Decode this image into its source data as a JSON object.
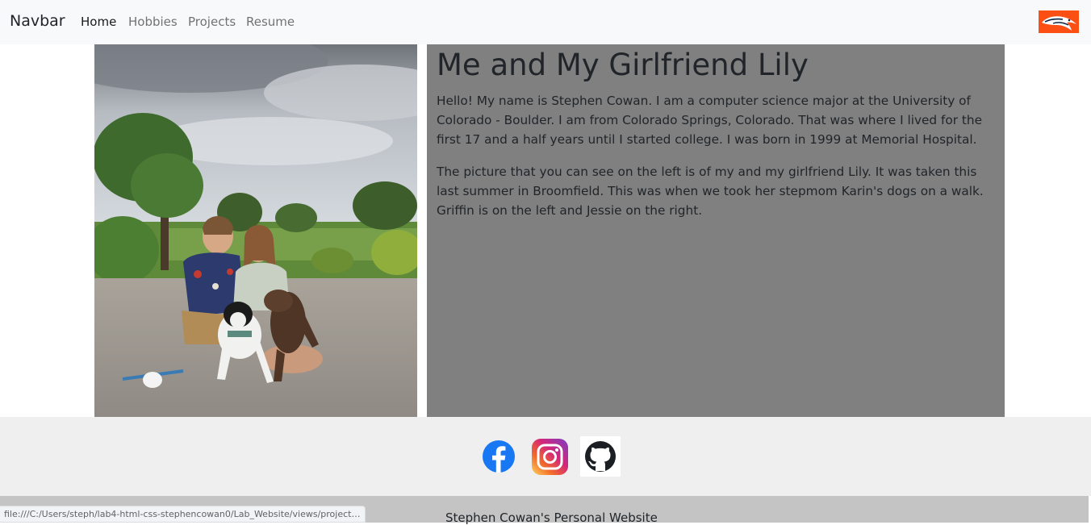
{
  "navbar": {
    "brand": "Navbar",
    "links": [
      {
        "label": "Home"
      },
      {
        "label": "Hobbies"
      },
      {
        "label": "Projects"
      },
      {
        "label": "Resume"
      }
    ],
    "logo_icon": "broncos-logo-icon"
  },
  "main": {
    "photo_icon": "couple-with-dogs-photo",
    "heading": "Me and My Girlfriend Lily",
    "paragraphs": [
      "Hello! My name is Stephen Cowan. I am a computer science major at the University of Colorado - Boulder. I am from Colorado Springs, Colorado. That was where I lived for the first 17 and a half years until I started college. I was born in 1999 at Memorial Hospital.",
      "The picture that you can see on the left is of my and my girlfriend Lily. It was taken this last summer in Broomfield. This was when we took her stepmom Karin's dogs on a walk. Griffin is on the left and Jessie on the right."
    ]
  },
  "social": {
    "icons": [
      "facebook-icon",
      "instagram-icon",
      "github-icon"
    ]
  },
  "footer": {
    "text": "Stephen Cowan's Personal Website"
  },
  "status_bar": {
    "url": "file:///C:/Users/steph/lab4-html-css-stephencowan0/Lab_Website/views/projects...."
  },
  "colors": {
    "navbar_bg": "#f8f9fa",
    "panel_bg": "#808080",
    "social_bg": "#efefef",
    "footer_bg": "#c4c4c4",
    "broncos_orange": "#fb4f14",
    "facebook_blue": "#1877f2"
  }
}
